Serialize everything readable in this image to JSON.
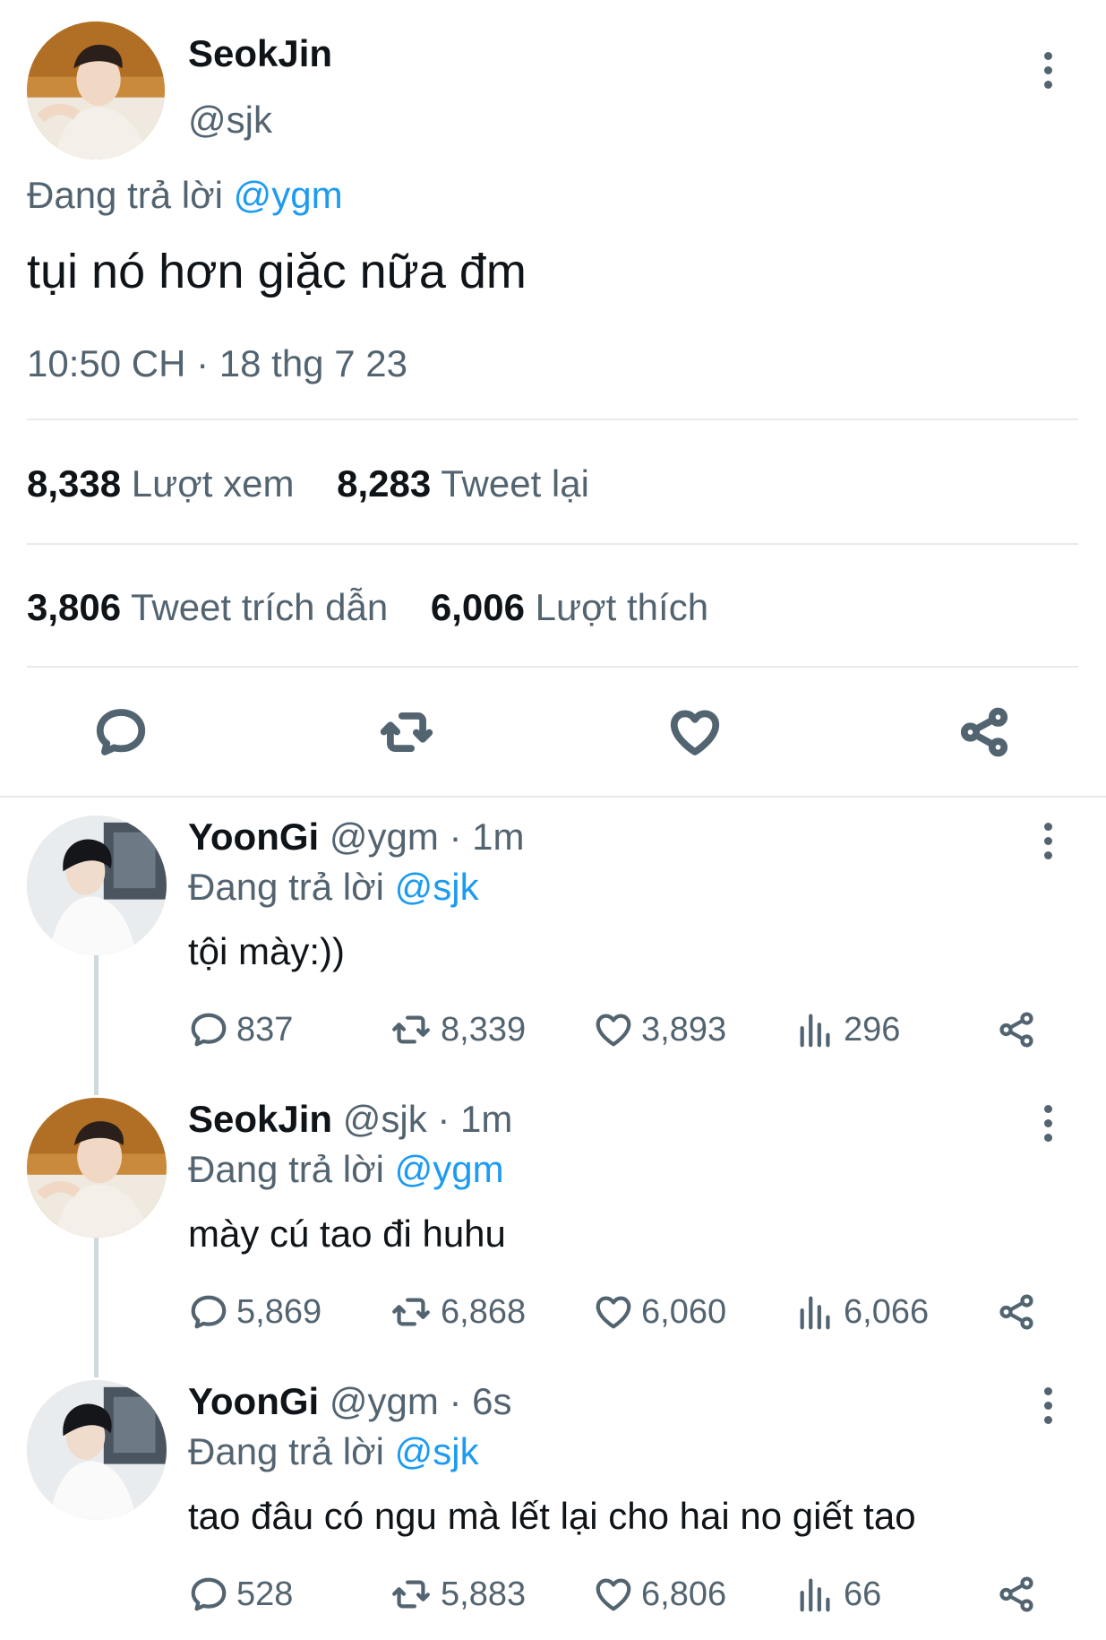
{
  "main_tweet": {
    "name": "SeokJin",
    "handle": "@sjk",
    "replying_prefix": "Đang trả lời",
    "replying_to": "@ygm",
    "text": "tụi nó hơn giặc nữa đm",
    "timestamp": "10:50 CH · 18 thg 7 23",
    "stats": {
      "views_count": "8,338",
      "views_label": "Lượt xem",
      "retweets_count": "8,283",
      "retweets_label": "Tweet lại",
      "quotes_count": "3,806",
      "quotes_label": "Tweet trích dẫn",
      "likes_count": "6,006",
      "likes_label": "Lượt thích"
    }
  },
  "replies": [
    {
      "name": "YoonGi",
      "handle": "@ygm",
      "time": "· 1m",
      "replying_prefix": "Đang trả lời",
      "replying_to": "@sjk",
      "text": "tội mày:))",
      "replies": "837",
      "retweets": "8,339",
      "likes": "3,893",
      "views": "296"
    },
    {
      "name": "SeokJin",
      "handle": "@sjk",
      "time": "· 1m",
      "replying_prefix": "Đang trả lời",
      "replying_to": "@ygm",
      "text": "mày cú tao đi huhu",
      "replies": "5,869",
      "retweets": "6,868",
      "likes": "6,060",
      "views": "6,066"
    },
    {
      "name": "YoonGi",
      "handle": "@ygm",
      "time": "· 6s",
      "replying_prefix": "Đang trả lời",
      "replying_to": "@sjk",
      "text": "tao đâu có ngu mà lết lại cho hai no giết tao",
      "replies": "528",
      "retweets": "5,883",
      "likes": "6,806",
      "views": "66"
    }
  ],
  "colors": {
    "accent": "#1d9bf0",
    "text": "#0f1419",
    "secondary": "#536471",
    "divider": "#e7e9ea"
  }
}
